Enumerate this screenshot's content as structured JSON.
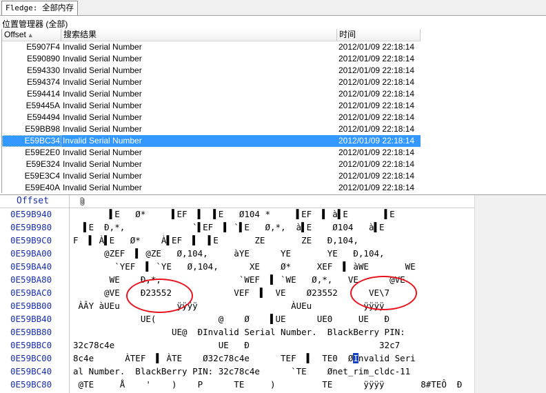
{
  "tab": {
    "prefix": "Fledge: ",
    "label": "全部内存"
  },
  "pane_label": "位置管理器 (全部)",
  "table": {
    "columns": {
      "offset": "Offset",
      "result": "搜索结果",
      "time": "时间"
    },
    "rows": [
      {
        "offset": "E5907F4",
        "result": "Invalid Serial Number",
        "time": "2012/01/09  22:18:14"
      },
      {
        "offset": "E590890",
        "result": "Invalid Serial Number",
        "time": "2012/01/09  22:18:14"
      },
      {
        "offset": "E594330",
        "result": "Invalid Serial Number",
        "time": "2012/01/09  22:18:14"
      },
      {
        "offset": "E594374",
        "result": "Invalid Serial Number",
        "time": "2012/01/09  22:18:14"
      },
      {
        "offset": "E594414",
        "result": "Invalid Serial Number",
        "time": "2012/01/09  22:18:14"
      },
      {
        "offset": "E59445A",
        "result": "Invalid Serial Number",
        "time": "2012/01/09  22:18:14"
      },
      {
        "offset": "E594494",
        "result": "Invalid Serial Number",
        "time": "2012/01/09  22:18:14"
      },
      {
        "offset": "E59BB98",
        "result": "Invalid Serial Number",
        "time": "2012/01/09  22:18:14"
      },
      {
        "offset": "E59BC34",
        "result": "Invalid Serial Number",
        "time": "2012/01/09  22:18:14"
      },
      {
        "offset": "E59E2E0",
        "result": "Invalid Serial Number",
        "time": "2012/01/09  22:18:14"
      },
      {
        "offset": "E59E324",
        "result": "Invalid Serial Number",
        "time": "2012/01/09  22:18:14"
      },
      {
        "offset": "E59E3C4",
        "result": "Invalid Serial Number",
        "time": "2012/01/09  22:18:14"
      },
      {
        "offset": "E59E40A",
        "result": "Invalid Serial Number",
        "time": "2012/01/09  22:18:14"
      }
    ],
    "selected_offset": "E59BC34"
  },
  "hex": {
    "offset_label": "Offset",
    "clip_icon": "paperclip-icon",
    "lines": [
      {
        "addr": "0E59B940",
        "text": "       ▌E   Ø*     ▌EF  ▌  ▌E   Ø104 *     ▌EF  ▌ à▌E       ▌E"
      },
      {
        "addr": "0E59B980",
        "text": "  ▌E  Ð,*,             `▌EF  ▌ `▌E   Ø,*,  à▌E    Ø104   à▌E"
      },
      {
        "addr": "0E59B9C0",
        "text": "F  ▌ À▌E   Ø*    À▌EF  ▌  ▌E       ZE       ZE   Ð,104,"
      },
      {
        "addr": "0E59BA00",
        "text": "      @ZEF  ▌ @ZE   Ø,104,     àYE      YE       YE   Ð,104,"
      },
      {
        "addr": "0E59BA40",
        "text": "        `YEF  ▌ `YE   Ø,104,      XE    Ø*     XEF  ▌ àWE       WE"
      },
      {
        "addr": "0E59BA80",
        "text": "       WE    Ð,*,               `WEF  ▌ `WE   Ø,*,   VE      @VE"
      },
      {
        "addr": "0E59BAC0",
        "text": "      @VE    Ð23552            VEF  ▌  VE    Ø23552      VE\\7"
      },
      {
        "addr": "0E59BB00",
        "text": " ÀÂY àUEu           ÿÿÿÿ                  ÀUEu          ÿÿÿÿ"
      },
      {
        "addr": "0E59BB40",
        "text": "             UE(            @    Ø    ▌UE      UE0     UE   Ð"
      },
      {
        "addr": "0E59BB80",
        "text": "                   UE@  ÐInvalid Serial Number.  BlackBerry PIN:"
      },
      {
        "addr": "0E59BBC0",
        "text": "32c78c4e                    UE   Ð                         32c7"
      },
      {
        "addr": "0E59BC00",
        "text": "8c4e      ÀTEF  ▌ ÀTE    Ø32c78c4e      TEF  ▌  TE0  Ø",
        "cursor": "I",
        "tail": "nvalid Seri"
      },
      {
        "addr": "0E59BC40",
        "text": "al Number.  BlackBerry PIN: 32c78c4e      `TE    Ønet_rim_cldc-11"
      },
      {
        "addr": "0E59BC80",
        "text": " @TE     Å    '    )    P      TE     )         TE      ÿÿÿÿ       8#TEÔ  Ð"
      }
    ]
  },
  "colors": {
    "selection": "#3399ff",
    "offset_blue": "#1a2fb0",
    "annotation_red": "#e8121c"
  }
}
